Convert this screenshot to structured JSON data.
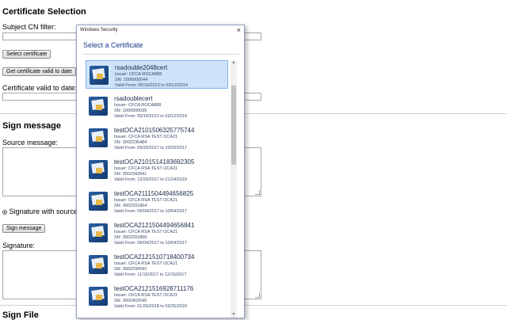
{
  "page": {
    "cert_selection_title": "Certificate Selection",
    "subject_cn_label": "Subject CN filter:",
    "select_certificate_btn": "Select certificate",
    "get_valid_date_btn": "Get certificate valid to date",
    "valid_to_label": "Certificate valid to date:",
    "sign_message_title": "Sign message",
    "source_message_label": "Source message:",
    "signature_radio_label": "Signature with source",
    "sign_message_btn": "Sign message",
    "signature_label": "Signature:",
    "sign_file_title": "Sign File"
  },
  "dialog": {
    "window_title": "Windows Security",
    "close_glyph": "×",
    "heading": "Select a Certificate",
    "certificates": [
      {
        "name": "rsadouble2048cert",
        "issuer": "Issuer: CFCA ROCA888",
        "sn": "SN: 1000000044",
        "valid": "Valid From: 05/16/2013 to 03/12/2014",
        "selected": true
      },
      {
        "name": "rsadoublecert",
        "issuer": "Issuer: CFCA ROCA888",
        "sn": "SN: 1000000039",
        "valid": "Valid From: 05/16/2013 to 03/12/2014",
        "selected": false
      },
      {
        "name": "testOCA2101506325775744",
        "issuer": "Issuer: CFCA RSA TEST OCA21",
        "sn": "SN: 3002236484",
        "valid": "Valid From: 09/25/2017 to 10/25/2017",
        "selected": false
      },
      {
        "name": "testOCA2101514183692305",
        "issuer": "Issuer: CFCA RSA TEST OCA21",
        "sn": "SN: 3002343941",
        "valid": "Valid From: 12/25/2017 to 01/24/2018",
        "selected": false
      },
      {
        "name": "testOCA2111504494656825",
        "issuer": "Issuer: CFCA RSA TEST OCA21",
        "sn": "SN: 3002201864",
        "valid": "Valid From: 09/04/2017 to 10/04/2017",
        "selected": false
      },
      {
        "name": "testOCA2121504494656841",
        "issuer": "Issuer: CFCA RSA TEST OCA21",
        "sn": "SN: 3002201868",
        "valid": "Valid From: 09/04/2017 to 10/04/2017",
        "selected": false
      },
      {
        "name": "testOCA2121510718400734",
        "issuer": "Issuer: CFCA RSA TEST OCA21",
        "sn": "SN: 3002290542",
        "valid": "Valid From: 11/15/2017 to 12/15/2017",
        "selected": false
      },
      {
        "name": "testOCA2121516928711176",
        "issuer": "Issuer: CFCA RSA TEST OCA21",
        "sn": "SN: 3002402545",
        "valid": "Valid From: 01/26/2018 to 02/25/2018",
        "selected": false
      }
    ]
  },
  "icons": {
    "certificate": "certificate-icon",
    "close": "close-icon"
  },
  "colors": {
    "selection_bg": "#cde3fa",
    "selection_border": "#7eb4ea",
    "heading": "#1a3a8a"
  }
}
